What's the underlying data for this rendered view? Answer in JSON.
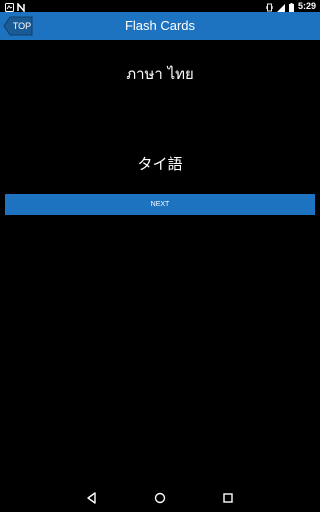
{
  "status_bar": {
    "time": "5:29",
    "icons": [
      "notification-icon",
      "n-icon",
      "vibrate-icon",
      "signal-icon",
      "battery-icon"
    ]
  },
  "app_bar": {
    "back_label": "TOP",
    "title": "Flash Cards",
    "color": "#1e73c1"
  },
  "card": {
    "front": "ภาษา ไทย",
    "back": "タイ語"
  },
  "next_button": {
    "label": "NEXT"
  },
  "nav_bar": {
    "icons": [
      "back-icon",
      "home-icon",
      "recents-icon"
    ]
  }
}
